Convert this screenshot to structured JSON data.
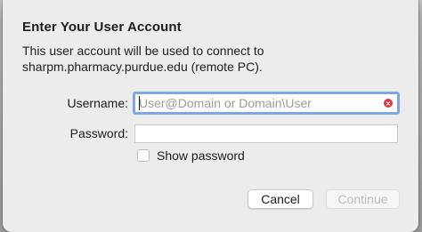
{
  "dialog": {
    "title": "Enter Your User Account",
    "description_line1": "This user account will be used to connect to",
    "description_line2": "sharpm.pharmacy.purdue.edu (remote PC)."
  },
  "form": {
    "username_label": "Username:",
    "username_placeholder": "User@Domain or Domain\\User",
    "username_value": "",
    "password_label": "Password:",
    "password_value": "",
    "show_password_label": "Show password",
    "show_password_checked": false
  },
  "buttons": {
    "cancel_label": "Cancel",
    "continue_label": "Continue",
    "continue_enabled": false
  },
  "colors": {
    "focus_ring": "#7fa7e3",
    "clear_icon": "#e5323b"
  }
}
